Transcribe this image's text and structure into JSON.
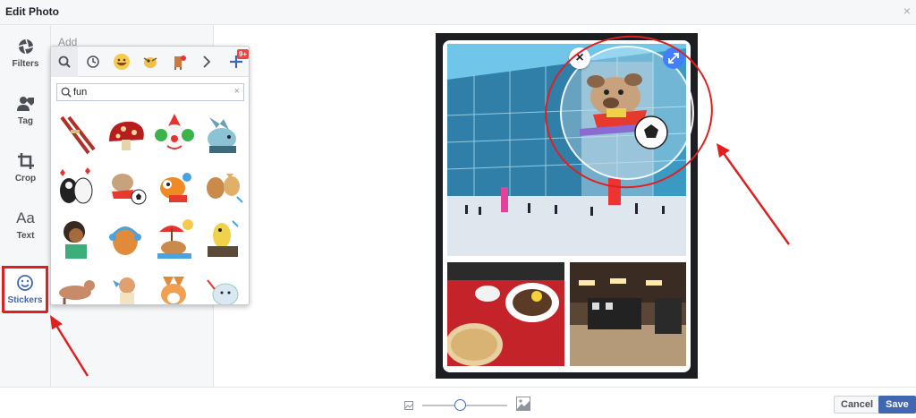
{
  "dialog": {
    "title": "Edit Photo",
    "close_glyph": "×"
  },
  "tools": [
    {
      "label": "Filters",
      "icon": "filters-icon"
    },
    {
      "label": "Tag",
      "icon": "tag-icon"
    },
    {
      "label": "Crop",
      "icon": "crop-icon"
    },
    {
      "label": "Text",
      "icon_text": "Aa"
    },
    {
      "label": "Stickers",
      "icon": "smiley-icon",
      "active": true
    }
  ],
  "panel2": {
    "hint": "Add"
  },
  "sticker_picker": {
    "tabs": [
      "search-tab",
      "recent-tab",
      "sticker-pack-1",
      "sticker-pack-2",
      "sticker-pack-3",
      "next-tab",
      "store-tab"
    ],
    "store_badge": "9+",
    "search": {
      "value": "fun",
      "clear_glyph": "×"
    }
  },
  "footer": {
    "cancel_label": "Cancel",
    "save_label": "Save",
    "zoom_percent": 45
  },
  "colors": {
    "accent": "#4267b2",
    "annotation_red": "#e02020",
    "sticker_resize": "#4080ff"
  }
}
